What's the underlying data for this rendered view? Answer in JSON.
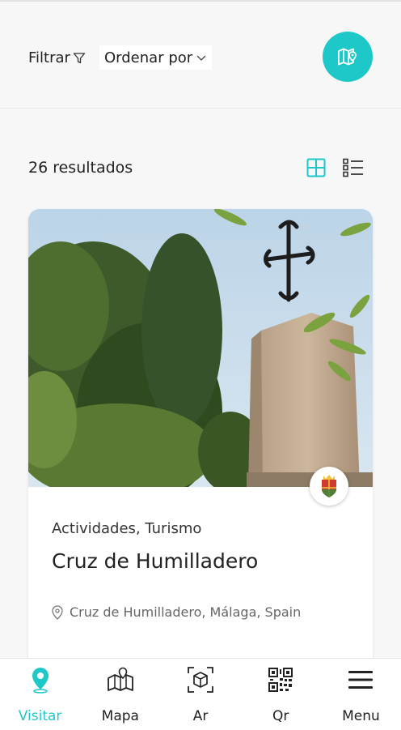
{
  "toolbar": {
    "filter_label": "Filtrar",
    "sort_label": "Ordenar por",
    "map_button_icon": "map-pin-icon"
  },
  "results": {
    "count_label": "26 resultados",
    "grid_icon": "grid-view-icon",
    "list_icon": "list-view-icon"
  },
  "card": {
    "categories": "Actividades,  Turismo",
    "title": "Cruz de Humilladero",
    "location": "Cruz de Humilladero, Málaga, Spain"
  },
  "nav": {
    "items": [
      {
        "label": "Visitar",
        "icon": "location-pin-icon",
        "active": true
      },
      {
        "label": "Mapa",
        "icon": "map-icon",
        "active": false
      },
      {
        "label": "Ar",
        "icon": "ar-cube-icon",
        "active": false
      },
      {
        "label": "Qr",
        "icon": "qr-code-icon",
        "active": false
      },
      {
        "label": "Menu",
        "icon": "hamburger-menu-icon",
        "active": false
      }
    ]
  },
  "colors": {
    "accent": "#1ec8c8",
    "text": "#222222"
  }
}
